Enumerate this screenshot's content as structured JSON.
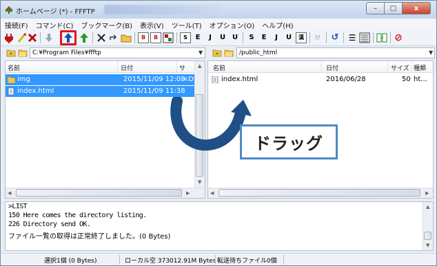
{
  "window": {
    "title": "ホームページ (*) - FFFTP",
    "buttons": {
      "minimize": "–",
      "maximize": "□",
      "close": "x"
    }
  },
  "menu": {
    "items": [
      "接続(F)",
      "コマンド(C)",
      "ブックマーク(B)",
      "表示(V)",
      "ツール(T)",
      "オプション(O)",
      "ヘルプ(H)"
    ]
  },
  "toolbar": {
    "icons": [
      "connect-icon",
      "quick-connect-icon",
      "disconnect-icon",
      "download-icon",
      "upload-icon",
      "mirror-upload-icon",
      "delete-icon",
      "rename-icon",
      "mkdir-icon",
      "binary-mode-icon",
      "binary-mode-icon",
      "auto-mode-icon"
    ],
    "labels": {
      "B1": "B",
      "B2": "B",
      "B3": "",
      "S1": "S",
      "E1": "E",
      "J1": "J",
      "U1": "U",
      "U2": "U",
      "S2": "S",
      "E2": "E",
      "J2": "J",
      "U3": "U",
      "kanji": "漢",
      "kana": "ｶﾅ",
      "refresh": "↺",
      "list": "☰",
      "sync": "",
      "stop": "⊘"
    },
    "highlight_color": "#e3141c"
  },
  "local": {
    "path": "C:¥Program Files¥ffftp",
    "columns": [
      "名前",
      "日付",
      "サ"
    ],
    "files": [
      {
        "name": "img",
        "date": "2015/11/09 12:08",
        "size": "<D",
        "type": "folder",
        "selected": true
      },
      {
        "name": "index.html",
        "date": "2015/11/09 11:38",
        "size": "",
        "type": "file",
        "selected": true
      }
    ]
  },
  "remote": {
    "path": "/public_html",
    "columns": [
      "名前",
      "日付",
      "サイズ",
      "種類"
    ],
    "files": [
      {
        "name": "index.html",
        "date": "2016/06/28",
        "size": "50",
        "type": "ht...",
        "selected": false
      }
    ]
  },
  "log": {
    "lines": [
      ">LIST",
      "150 Here comes the directory listing.",
      "226 Directory send OK.",
      "ファイル一覧の取得は正常終了しました。(0 Bytes)"
    ]
  },
  "status": {
    "selection": "選択1個 (0 Bytes)",
    "local_free": "ローカル空 373012.91M Bytes",
    "queue": "転送待ちファイル0個"
  },
  "overlay": {
    "label": "ドラッグ",
    "arrow_color": "#1f4f84",
    "border_color": "#4d88c8"
  }
}
